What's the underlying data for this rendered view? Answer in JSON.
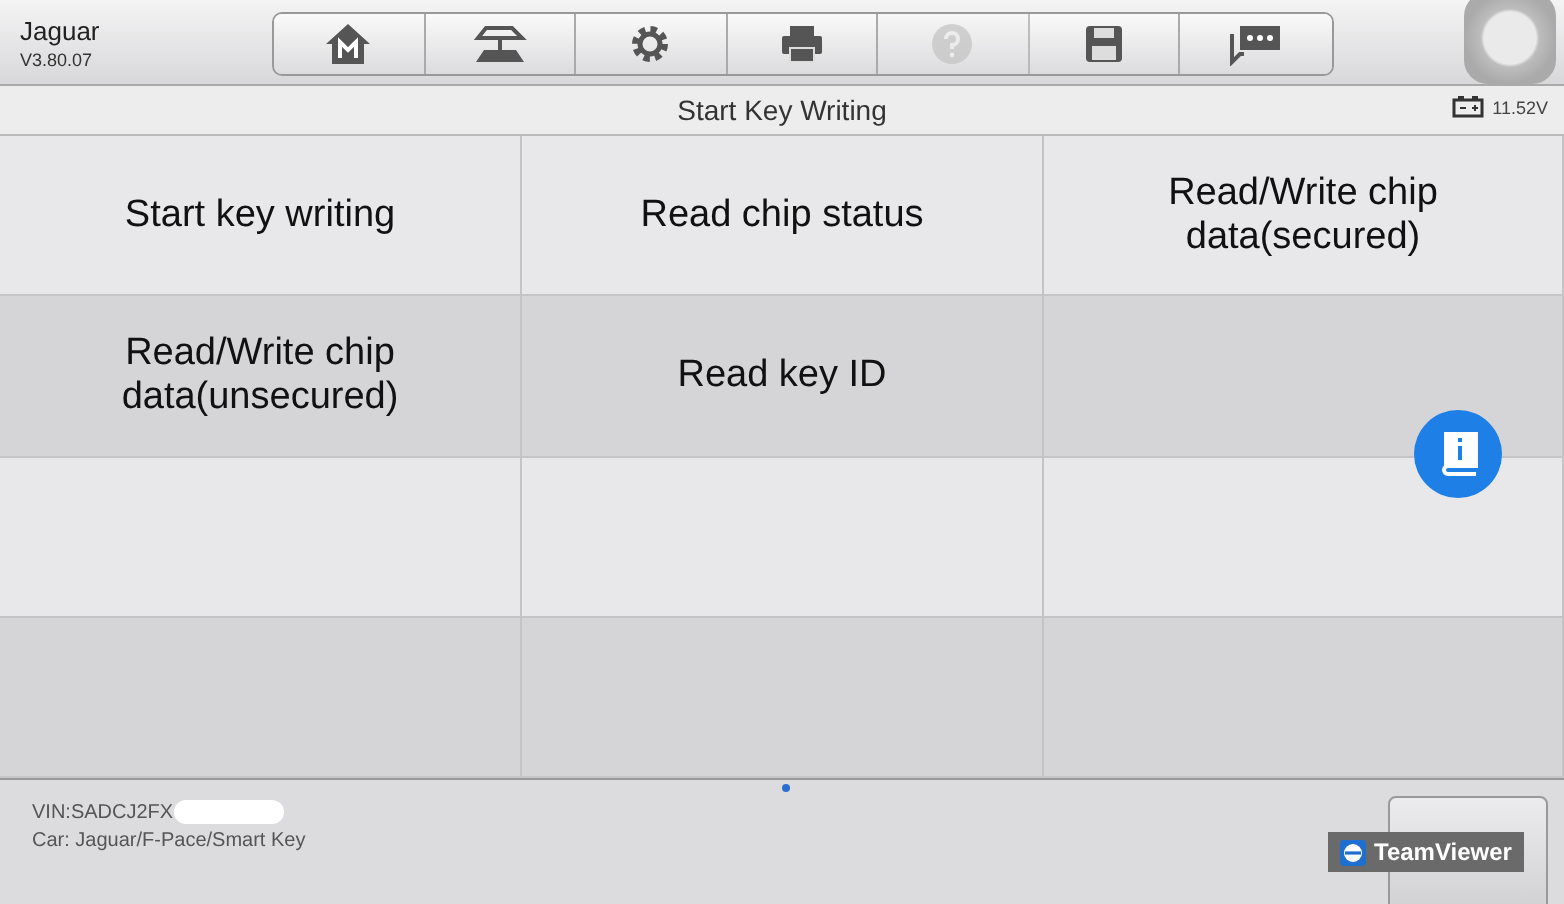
{
  "header": {
    "make": "Jaguar",
    "version": "V3.80.07"
  },
  "toolbar": [
    {
      "kind": "home",
      "disabled": false
    },
    {
      "kind": "car",
      "disabled": false
    },
    {
      "kind": "settings",
      "disabled": false
    },
    {
      "kind": "print",
      "disabled": false
    },
    {
      "kind": "help",
      "disabled": true
    },
    {
      "kind": "save",
      "disabled": false
    },
    {
      "kind": "chat",
      "disabled": false
    }
  ],
  "title_bar": {
    "title": "Start Key Writing",
    "voltage": "11.52V"
  },
  "functions": [
    {
      "label": "Start key writing"
    },
    {
      "label": "Read chip status"
    },
    {
      "label": "Read/Write chip data(secured)"
    },
    {
      "label": "Read/Write chip data(unsecured)"
    },
    {
      "label": "Read key ID"
    }
  ],
  "footer": {
    "vin": "VIN:SADCJ2FX",
    "car": "Car: Jaguar/F-Pace/Smart Key",
    "badge": "TeamViewer"
  }
}
